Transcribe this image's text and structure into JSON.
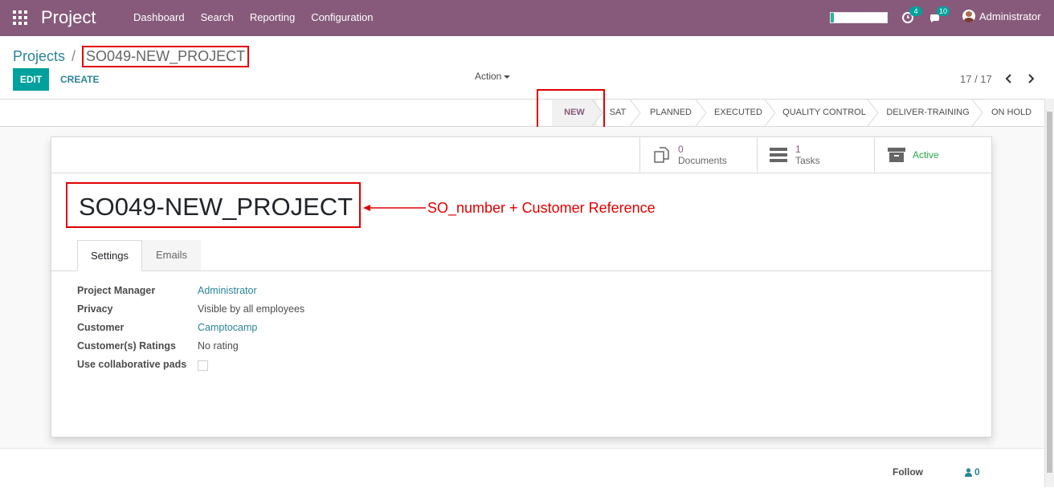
{
  "navbar": {
    "app_title": "Project",
    "menu": [
      "Dashboard",
      "Search",
      "Reporting",
      "Configuration"
    ],
    "progress_fraction": 0.05,
    "activity_count": "4",
    "messages_count": "10",
    "user_name": "Administrator"
  },
  "breadcrumb": {
    "parent": "Projects",
    "separator": "/",
    "current": "SO049-NEW_PROJECT"
  },
  "buttons": {
    "edit": "EDIT",
    "create": "CREATE",
    "action": "Action"
  },
  "pager": {
    "text": "17 / 17"
  },
  "stages": [
    "NEW",
    "SAT",
    "PLANNED",
    "EXECUTED",
    "QUALITY CONTROL",
    "DELIVER-TRAINING",
    "ON HOLD"
  ],
  "active_stage": "NEW",
  "smart_buttons": {
    "documents": {
      "count": "0",
      "label": "Documents"
    },
    "tasks": {
      "count": "1",
      "label": "Tasks"
    },
    "active": {
      "label": "Active"
    }
  },
  "record": {
    "name": "SO049-NEW_PROJECT",
    "annotation": "SO_number + Customer Reference"
  },
  "tabs": [
    "Settings",
    "Emails"
  ],
  "fields": {
    "project_manager": {
      "label": "Project Manager",
      "value": "Administrator"
    },
    "privacy": {
      "label": "Privacy",
      "value": "Visible by all employees"
    },
    "customer": {
      "label": "Customer",
      "value": "Camptocamp"
    },
    "ratings": {
      "label": "Customer(s) Ratings",
      "value": "No rating"
    },
    "pads": {
      "label": "Use collaborative pads",
      "checked": false
    }
  },
  "chatter": {
    "follow": "Follow",
    "followers": "0"
  },
  "colors": {
    "brand": "#875a7b",
    "primary": "#00a09d",
    "link": "#2c8397",
    "annotation_red": "#e00000",
    "active_green": "#28a745"
  }
}
